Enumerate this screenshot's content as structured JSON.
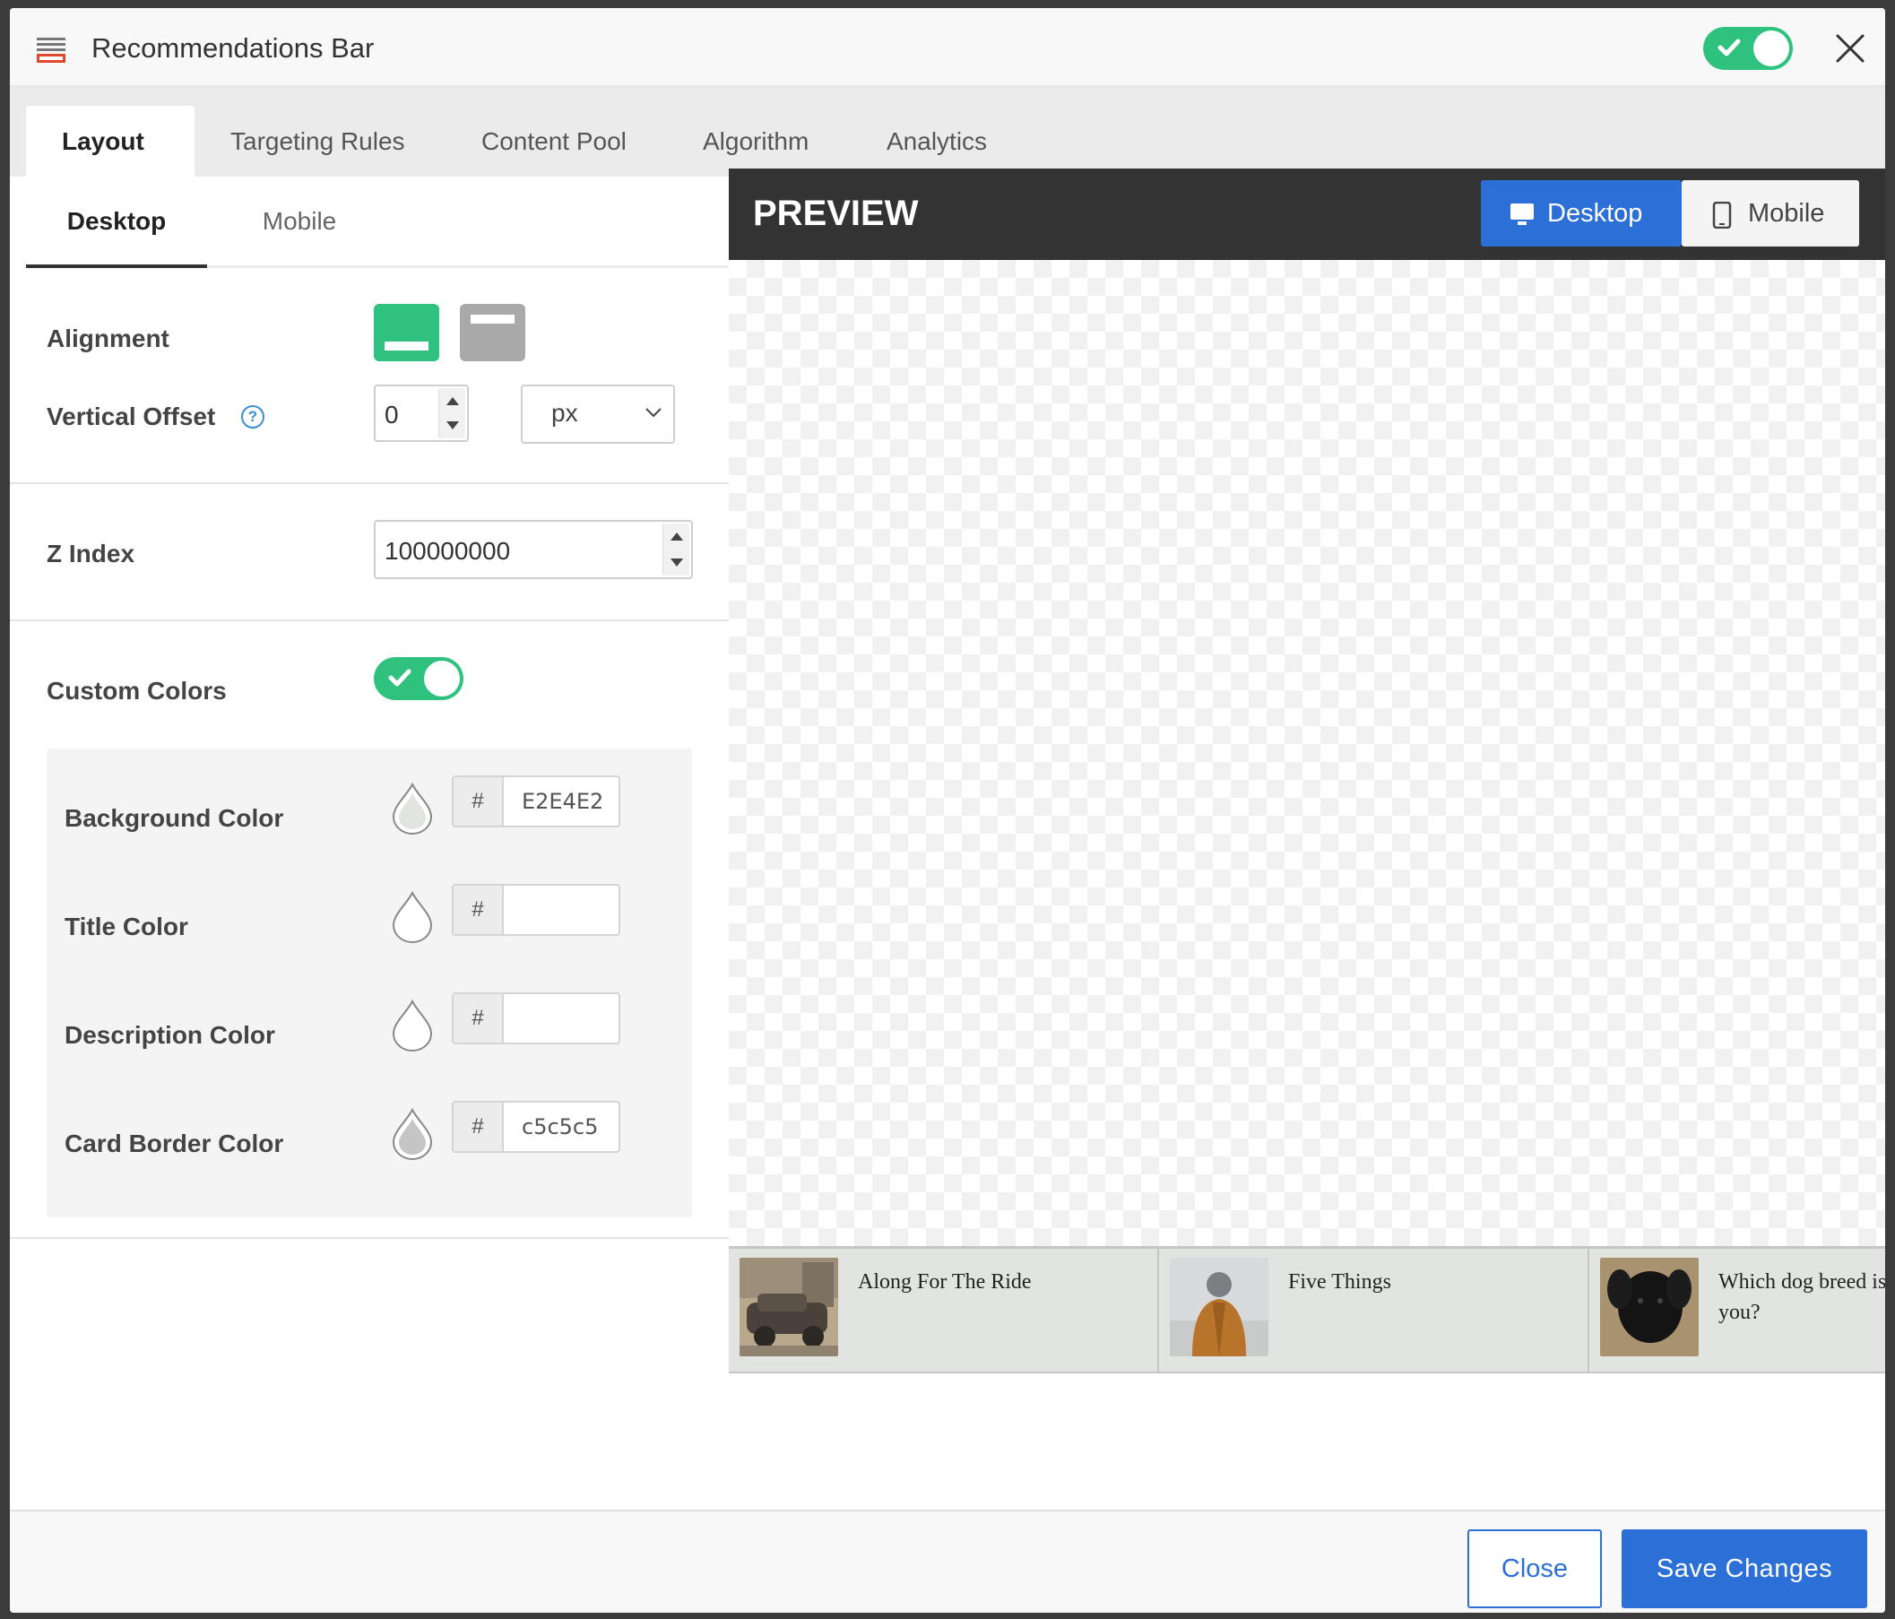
{
  "window": {
    "title": "Recommendations Bar",
    "enabled": true
  },
  "tabs": [
    {
      "label": "Layout",
      "active": true
    },
    {
      "label": "Targeting Rules"
    },
    {
      "label": "Content Pool"
    },
    {
      "label": "Algorithm"
    },
    {
      "label": "Analytics"
    }
  ],
  "subtabs": [
    {
      "label": "Desktop",
      "active": true
    },
    {
      "label": "Mobile"
    }
  ],
  "form": {
    "alignment_label": "Alignment",
    "alignment_selected": "bottom",
    "vertical_offset_label": "Vertical Offset",
    "vertical_offset_value": "0",
    "vertical_offset_unit": "px",
    "z_index_label": "Z Index",
    "z_index_value": "100000000",
    "custom_colors_label": "Custom Colors",
    "custom_colors_enabled": true,
    "hash": "#",
    "colors": [
      {
        "label": "Background Color",
        "value": "E2E4E2",
        "swatch": "#e2e4e2"
      },
      {
        "label": "Title Color",
        "value": "",
        "swatch": "#ffffff"
      },
      {
        "label": "Description Color",
        "value": "",
        "swatch": "#ffffff"
      },
      {
        "label": "Card Border Color",
        "value": "c5c5c5",
        "swatch": "#c5c5c5"
      }
    ]
  },
  "preview": {
    "title": "PREVIEW",
    "device_desktop": "Desktop",
    "device_mobile": "Mobile",
    "device_selected": "desktop",
    "cards": [
      {
        "title": "Along For The Ride",
        "thumb": "vintage-car-icon"
      },
      {
        "title": "Five Things",
        "thumb": "person-in-jacket-icon"
      },
      {
        "title": "Which dog breed is you?",
        "thumb": "black-dog-icon"
      }
    ]
  },
  "footer": {
    "close_label": "Close",
    "save_label": "Save Changes"
  },
  "colors": {
    "accent_green": "#2ec27e",
    "accent_blue": "#2c6fd6",
    "brand_red": "#e0482e"
  }
}
